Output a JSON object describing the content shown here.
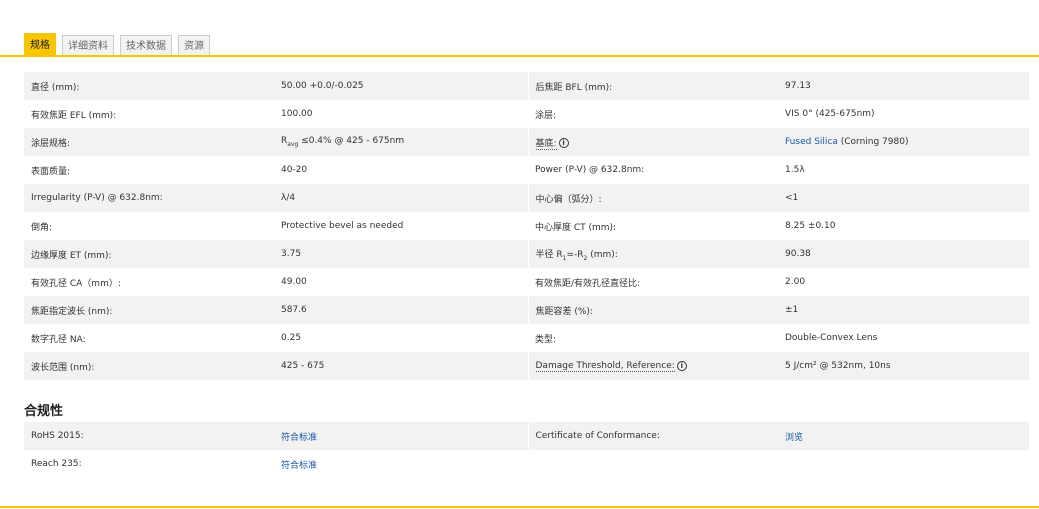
{
  "tabs": [
    {
      "label": "规格",
      "active": true
    },
    {
      "label": "详细资料",
      "active": false
    },
    {
      "label": "技术数据",
      "active": false
    },
    {
      "label": "资源",
      "active": false
    }
  ],
  "specs": {
    "rows": [
      {
        "k1": "直径 (mm):",
        "v1": "50.00 +0.0/-0.025",
        "k2": "后焦距 BFL (mm):",
        "v2": "97.13"
      },
      {
        "k1": "有效焦距 EFL (mm):",
        "v1": "100.00",
        "k2": "涂层:",
        "v2": "VIS 0° (425-675nm)"
      },
      {
        "k1": "涂层规格:",
        "v1_prefix": "R",
        "v1_sub": "avg",
        "v1_suffix": " ≤0.4% @ 425 - 675nm",
        "k2": "基底:",
        "v2_link": "Fused Silica",
        "v2_suffix": " (Corning 7980)"
      },
      {
        "k1": "表面质量:",
        "v1": "40-20",
        "k2": "Power (P-V) @ 632.8nm:",
        "v2": "1.5λ"
      },
      {
        "k1": "Irregularity (P-V) @ 632.8nm:",
        "v1": "λ/4",
        "k2": "中心偏（弧分）:",
        "v2": "<1"
      },
      {
        "k1": "倒角:",
        "v1": "Protective bevel as needed",
        "k2": "中心厚度 CT (mm):",
        "v2": "8.25 ±0.10"
      },
      {
        "k1": "边缘厚度 ET (mm):",
        "v1": "3.75",
        "k2_prefix": "半径 R",
        "k2_sub1": "1",
        "k2_mid": "=-R",
        "k2_sub2": "2",
        "k2_suffix": " (mm):",
        "v2": "90.38"
      },
      {
        "k1": "有效孔径 CA（mm）:",
        "v1": "49.00",
        "k2": "有效焦距/有效孔径直径比:",
        "v2": "2.00"
      },
      {
        "k1": "焦距指定波长 (nm):",
        "v1": "587.6",
        "k2": "焦距容差 (%):",
        "v2": "±1"
      },
      {
        "k1": "数字孔径 NA:",
        "v1": "0.25",
        "k2": "类型:",
        "v2": "Double-Convex Lens"
      },
      {
        "k1": "波长范围 (nm):",
        "v1": "425 - 675",
        "k2": "Damage Threshold, Reference:",
        "v2": "5 J/cm² @ 532nm, 10ns"
      }
    ],
    "info_glyph": "i"
  },
  "compliance": {
    "title": "合规性",
    "rows": [
      {
        "k1": "RoHS 2015:",
        "v1": "符合标准",
        "k2": "Certificate of Conformance:",
        "v2": "浏览"
      },
      {
        "k1": "Reach 235:",
        "v1": "符合标准",
        "k2": "",
        "v2": ""
      }
    ]
  },
  "colors": {
    "accent": "#f7c600",
    "link": "#1a5aa6",
    "row_alt": "#f2f2f2"
  }
}
